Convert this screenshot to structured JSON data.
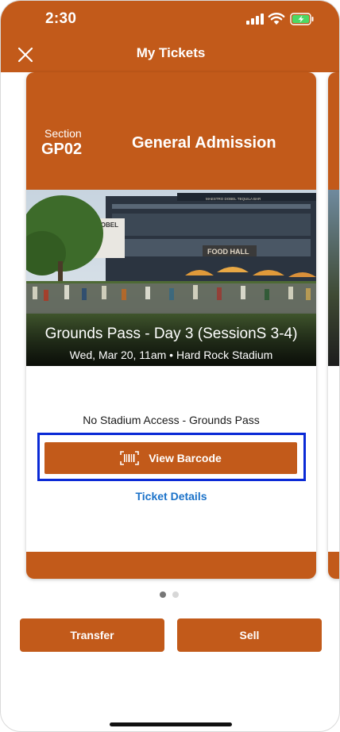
{
  "status_bar": {
    "time": "2:30"
  },
  "header": {
    "title": "My Tickets"
  },
  "ticket": {
    "section_label": "Section",
    "section_value": "GP02",
    "admission": "General Admission",
    "event_name": "Grounds Pass - Day 3 (SessionS 3-4)",
    "event_meta": "Wed, Mar 20, 11am • Hard Rock Stadium",
    "photo_signs": [
      "DOBEL",
      "FOOD HALL",
      "MAESTRO DOBEL TEQUILA BAR"
    ],
    "access_text": "No Stadium Access - Grounds Pass",
    "barcode_label": "View Barcode",
    "details_label": "Ticket Details"
  },
  "pager": {
    "total": 2,
    "active": 0
  },
  "actions": {
    "transfer_label": "Transfer",
    "sell_label": "Sell"
  },
  "colors": {
    "brand": "#c25a1a",
    "highlight": "#0a2ad6",
    "link": "#1b72c9"
  },
  "icons": [
    "close-icon",
    "barcode-icon",
    "signal-icon",
    "wifi-icon",
    "battery-icon"
  ]
}
